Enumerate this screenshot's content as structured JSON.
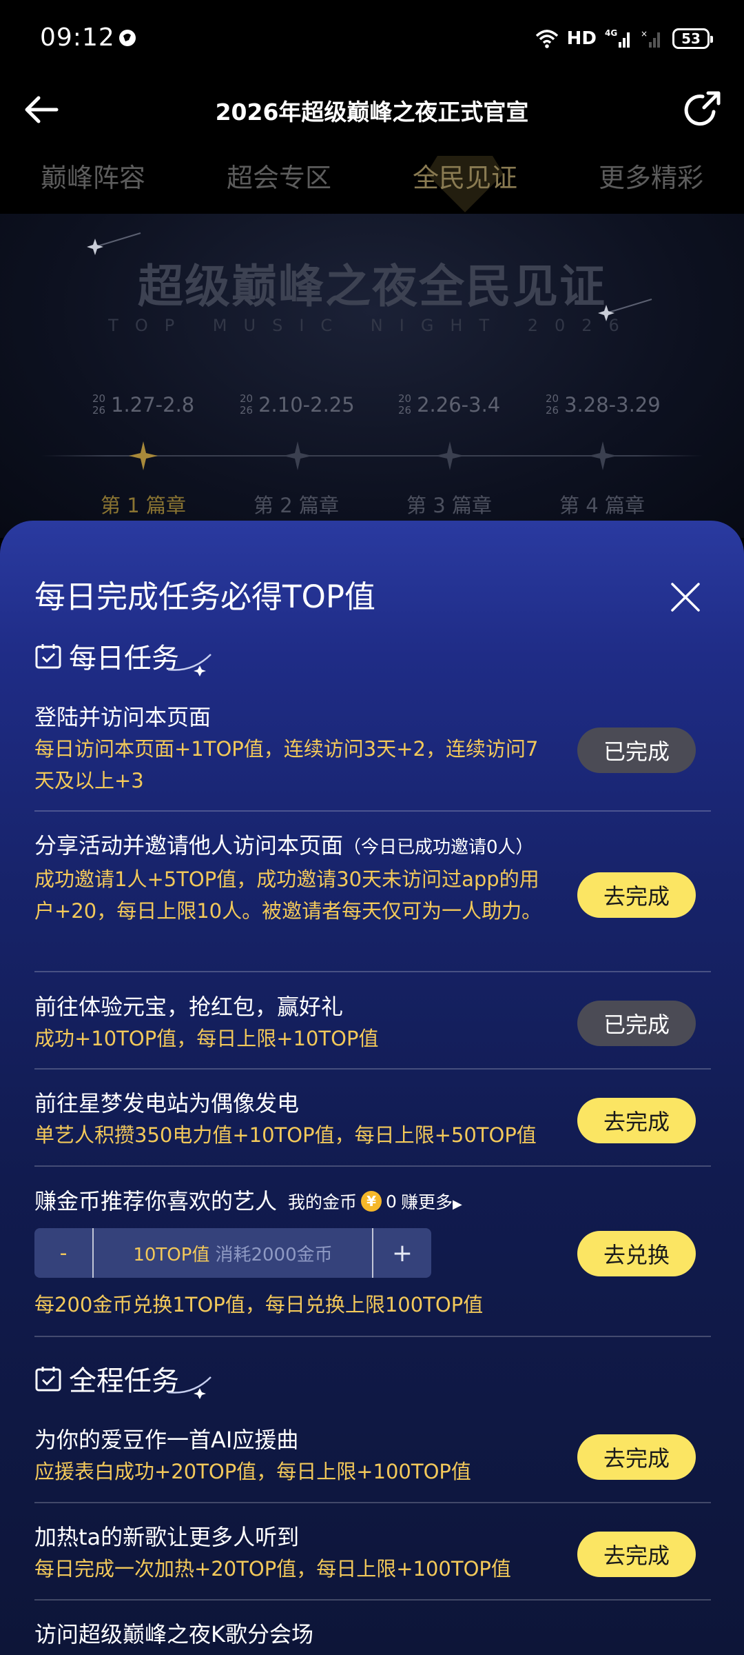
{
  "status_bar": {
    "time": "09:12",
    "network": "HD",
    "signal": "4G",
    "battery": "53"
  },
  "nav": {
    "title": "2026年超级巅峰之夜正式官宣"
  },
  "tabs": [
    {
      "label": "巅峰阵容"
    },
    {
      "label": "超会专区"
    },
    {
      "label": "全民见证"
    },
    {
      "label": "更多精彩"
    }
  ],
  "hero": {
    "title": "超级巅峰之夜全民见证",
    "subtitle": "TOP MUSIC NIGHT 2026",
    "dates": [
      {
        "yr_top": "20",
        "yr_bottom": "26",
        "range": "1.27-2.8"
      },
      {
        "yr_top": "20",
        "yr_bottom": "26",
        "range": "2.10-2.25"
      },
      {
        "yr_top": "20",
        "yr_bottom": "26",
        "range": "2.26-3.4"
      },
      {
        "yr_top": "20",
        "yr_bottom": "26",
        "range": "3.28-3.29"
      }
    ],
    "chapters": [
      "第 1 篇章",
      "第 2 篇章",
      "第 3 篇章",
      "第 4 篇章"
    ]
  },
  "panel": {
    "title": "每日完成任务必得TOP值",
    "daily_section": "每日任务",
    "full_section": "全程任务",
    "tasks": [
      {
        "title": "登陆并访问本页面",
        "desc": "每日访问本页面+1TOP值，连续访问3天+2，连续访问7天及以上+3",
        "button": "已完成"
      },
      {
        "title": "分享活动并邀请他人访问本页面",
        "note": "（今日已成功邀请0人）",
        "desc": "成功邀请1人+5TOP值，成功邀请30天未访问过app的用户+20，每日上限10人。被邀请者每天仅可为一人助力。",
        "button": "去完成"
      },
      {
        "title": "前往体验元宝，抢红包，赢好礼",
        "desc": "成功+10TOP值，每日上限+10TOP值",
        "button": "已完成"
      },
      {
        "title": "前往星梦发电站为偶像发电",
        "desc": "单艺人积攒350电力值+10TOP值，每日上限+50TOP值",
        "button": "去完成"
      },
      {
        "title": "赚金币推荐你喜欢的艺人",
        "desc": "每200金币兑换1TOP值，每日兑换上限100TOP值",
        "button": "去兑换"
      },
      {
        "title": "为你的爱豆作一首AI应援曲",
        "desc": "应援表白成功+20TOP值，每日上限+100TOP值",
        "button": "去完成"
      },
      {
        "title": "加热ta的新歌让更多人听到",
        "desc": "每日完成一次加热+20TOP值，每日上限+100TOP值",
        "button": "去完成"
      },
      {
        "title": "访问超级巅峰之夜K歌分会场"
      }
    ],
    "coins": {
      "label": "我的金币",
      "icon_glyph": "¥",
      "amount": "0",
      "earn_more": "赚更多"
    },
    "stepper": {
      "minus": "-",
      "value": "10TOP值",
      "cost": "消耗2000金币",
      "plus": "+"
    }
  },
  "colors": {
    "accent_yellow": "#fbe563",
    "desc_gold": "#f3c95a",
    "panel_blue": "#1f2c86",
    "done_gray": "#4b4b55"
  }
}
